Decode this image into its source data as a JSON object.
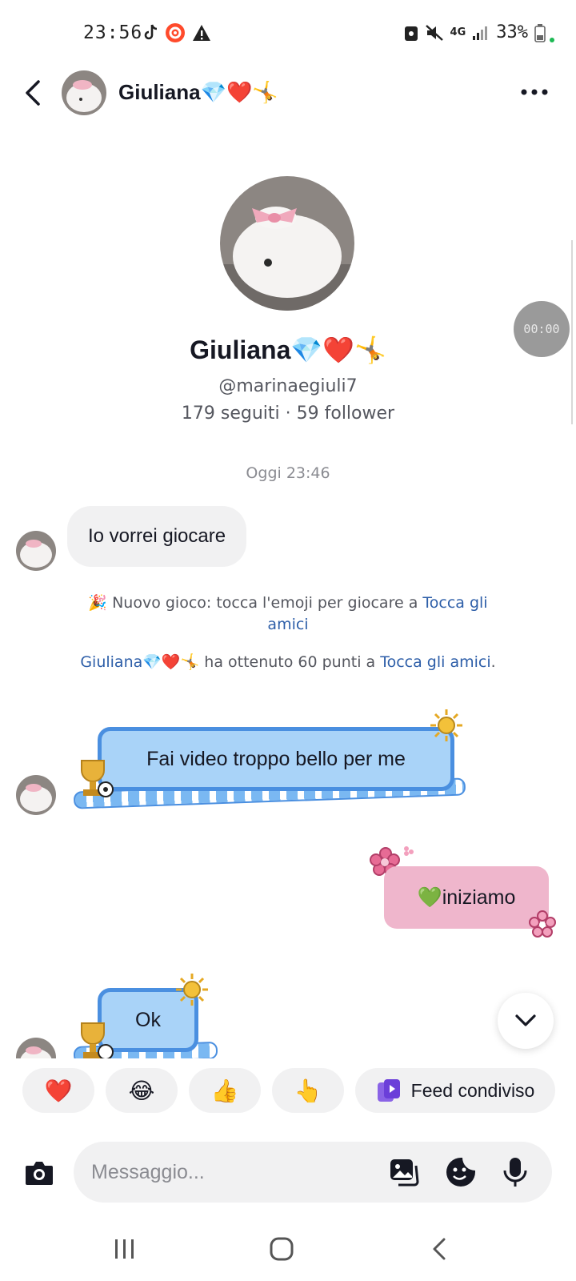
{
  "status_bar": {
    "time": "23:56",
    "network": "4G",
    "battery": "33%"
  },
  "header": {
    "contact_name": "Giuliana",
    "name_emojis": "💎❤️🤸"
  },
  "profile": {
    "name": "Giuliana",
    "name_emojis": "💎❤️🤸",
    "handle": "@marinaegiuli7",
    "stats": "179 seguiti · 59 follower"
  },
  "timer_overlay": "00:00",
  "chat": {
    "date_separator": "Oggi 23:46",
    "msg1": "Io vorrei giocare",
    "system1_prefix": "🎉 Nuovo gioco: tocca l'emoji per giocare a ",
    "system1_link": "Tocca gli amici",
    "system2_name": "Giuliana💎❤️🤸",
    "system2_middle": " ha ottenuto 60 punti a ",
    "system2_link": "Tocca gli amici",
    "system2_end": ".",
    "msg2": "Fai video troppo bello per me",
    "msg3": "💚iniziamo",
    "msg4": "Ok"
  },
  "quick_replies": {
    "r1": "❤️",
    "r2": "😂",
    "r3": "👍",
    "r4": "👆",
    "feed_label": "Feed condiviso"
  },
  "composer": {
    "placeholder": "Messaggio..."
  },
  "colors": {
    "blue_bubble": "#a9d3f8",
    "blue_border": "#4a8fe0",
    "pink_bubble": "#efb6cc",
    "grey_bubble": "#f1f1f2",
    "link": "#2d5ea8"
  }
}
